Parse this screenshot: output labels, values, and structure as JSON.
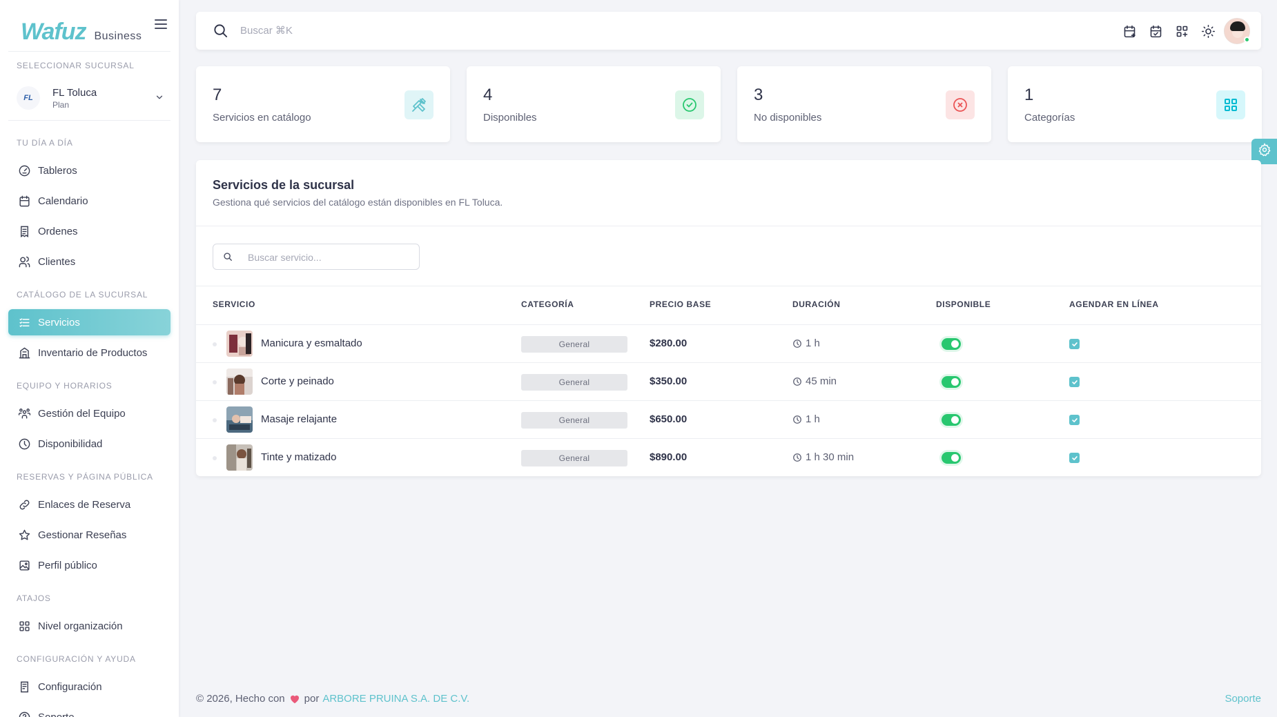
{
  "brand": {
    "logo": "Wafuz",
    "sub": "Business"
  },
  "branch": {
    "section_label": "SELECCIONAR SUCURSAL",
    "logo_text": "FL",
    "name": "FL Toluca",
    "plan": "Plan"
  },
  "sidebar": {
    "sections": [
      {
        "label": "TU DÍA A DÍA"
      },
      {
        "label": "CATÁLOGO DE LA SUCURSAL"
      },
      {
        "label": "EQUIPO Y HORARIOS"
      },
      {
        "label": "RESERVAS Y PÁGINA PÚBLICA"
      },
      {
        "label": "ATAJOS"
      },
      {
        "label": "CONFIGURACIÓN Y AYUDA"
      }
    ],
    "items": [
      {
        "label": "Tableros",
        "icon": "gauge-icon"
      },
      {
        "label": "Calendario",
        "icon": "calendar-icon"
      },
      {
        "label": "Ordenes",
        "icon": "receipt-icon"
      },
      {
        "label": "Clientes",
        "icon": "users-icon"
      },
      {
        "label": "Servicios",
        "icon": "list-icon",
        "active": true
      },
      {
        "label": "Inventario de Productos",
        "icon": "building-icon"
      },
      {
        "label": "Gestión del Equipo",
        "icon": "team-icon"
      },
      {
        "label": "Disponibilidad",
        "icon": "clock-icon"
      },
      {
        "label": "Enlaces de Reserva",
        "icon": "link-icon"
      },
      {
        "label": "Gestionar Reseñas",
        "icon": "star-icon"
      },
      {
        "label": "Perfil público",
        "icon": "image-icon"
      },
      {
        "label": "Nivel organización",
        "icon": "grid-icon"
      },
      {
        "label": "Configuración",
        "icon": "settings-doc-icon"
      },
      {
        "label": "Soporte",
        "icon": "help-icon"
      }
    ]
  },
  "topbar": {
    "search_placeholder": "Buscar ⌘K",
    "actions": [
      "calendar-plus-icon",
      "calendar-check-icon",
      "apps-icon",
      "sun-icon"
    ]
  },
  "stats": [
    {
      "value": "7",
      "label": "Servicios en catálogo",
      "icon": "tools-icon",
      "color": "#5ec2cc"
    },
    {
      "value": "4",
      "label": "Disponibles",
      "icon": "check-circle-icon",
      "color": "#28c76f"
    },
    {
      "value": "3",
      "label": "No disponibles",
      "icon": "x-circle-icon",
      "color": "#ea5455"
    },
    {
      "value": "1",
      "label": "Categorías",
      "icon": "category-icon",
      "color": "#00bad1"
    }
  ],
  "panel": {
    "title": "Servicios de la sucursal",
    "subtitle": "Gestiona qué servicios del catálogo están disponibles en FL Toluca.",
    "search_placeholder": "Buscar servicio...",
    "columns": {
      "service": "SERVICIO",
      "category": "CATEGORÍA",
      "price": "PRECIO BASE",
      "duration": "DURACIÓN",
      "available": "DISPONIBLE",
      "online": "AGENDAR EN LÍNEA"
    },
    "rows": [
      {
        "name": "Manicura y esmaltado",
        "category": "General",
        "price": "$280.00",
        "duration": "1 h",
        "available": true,
        "online": true
      },
      {
        "name": "Corte y peinado",
        "category": "General",
        "price": "$350.00",
        "duration": "45 min",
        "available": true,
        "online": true
      },
      {
        "name": "Masaje relajante",
        "category": "General",
        "price": "$650.00",
        "duration": "1 h",
        "available": true,
        "online": true
      },
      {
        "name": "Tinte y matizado",
        "category": "General",
        "price": "$890.00",
        "duration": "1 h 30 min",
        "available": true,
        "online": true
      }
    ]
  },
  "footer": {
    "prefix": "© 2026, Hecho con",
    "by": "por",
    "company": "ARBORE PRUINA S.A. DE C.V.",
    "support": "Soporte"
  },
  "colors": {
    "accent": "#5ec2cc",
    "success": "#28c76f",
    "danger": "#ea5455",
    "heart": "#ea5a7a"
  }
}
